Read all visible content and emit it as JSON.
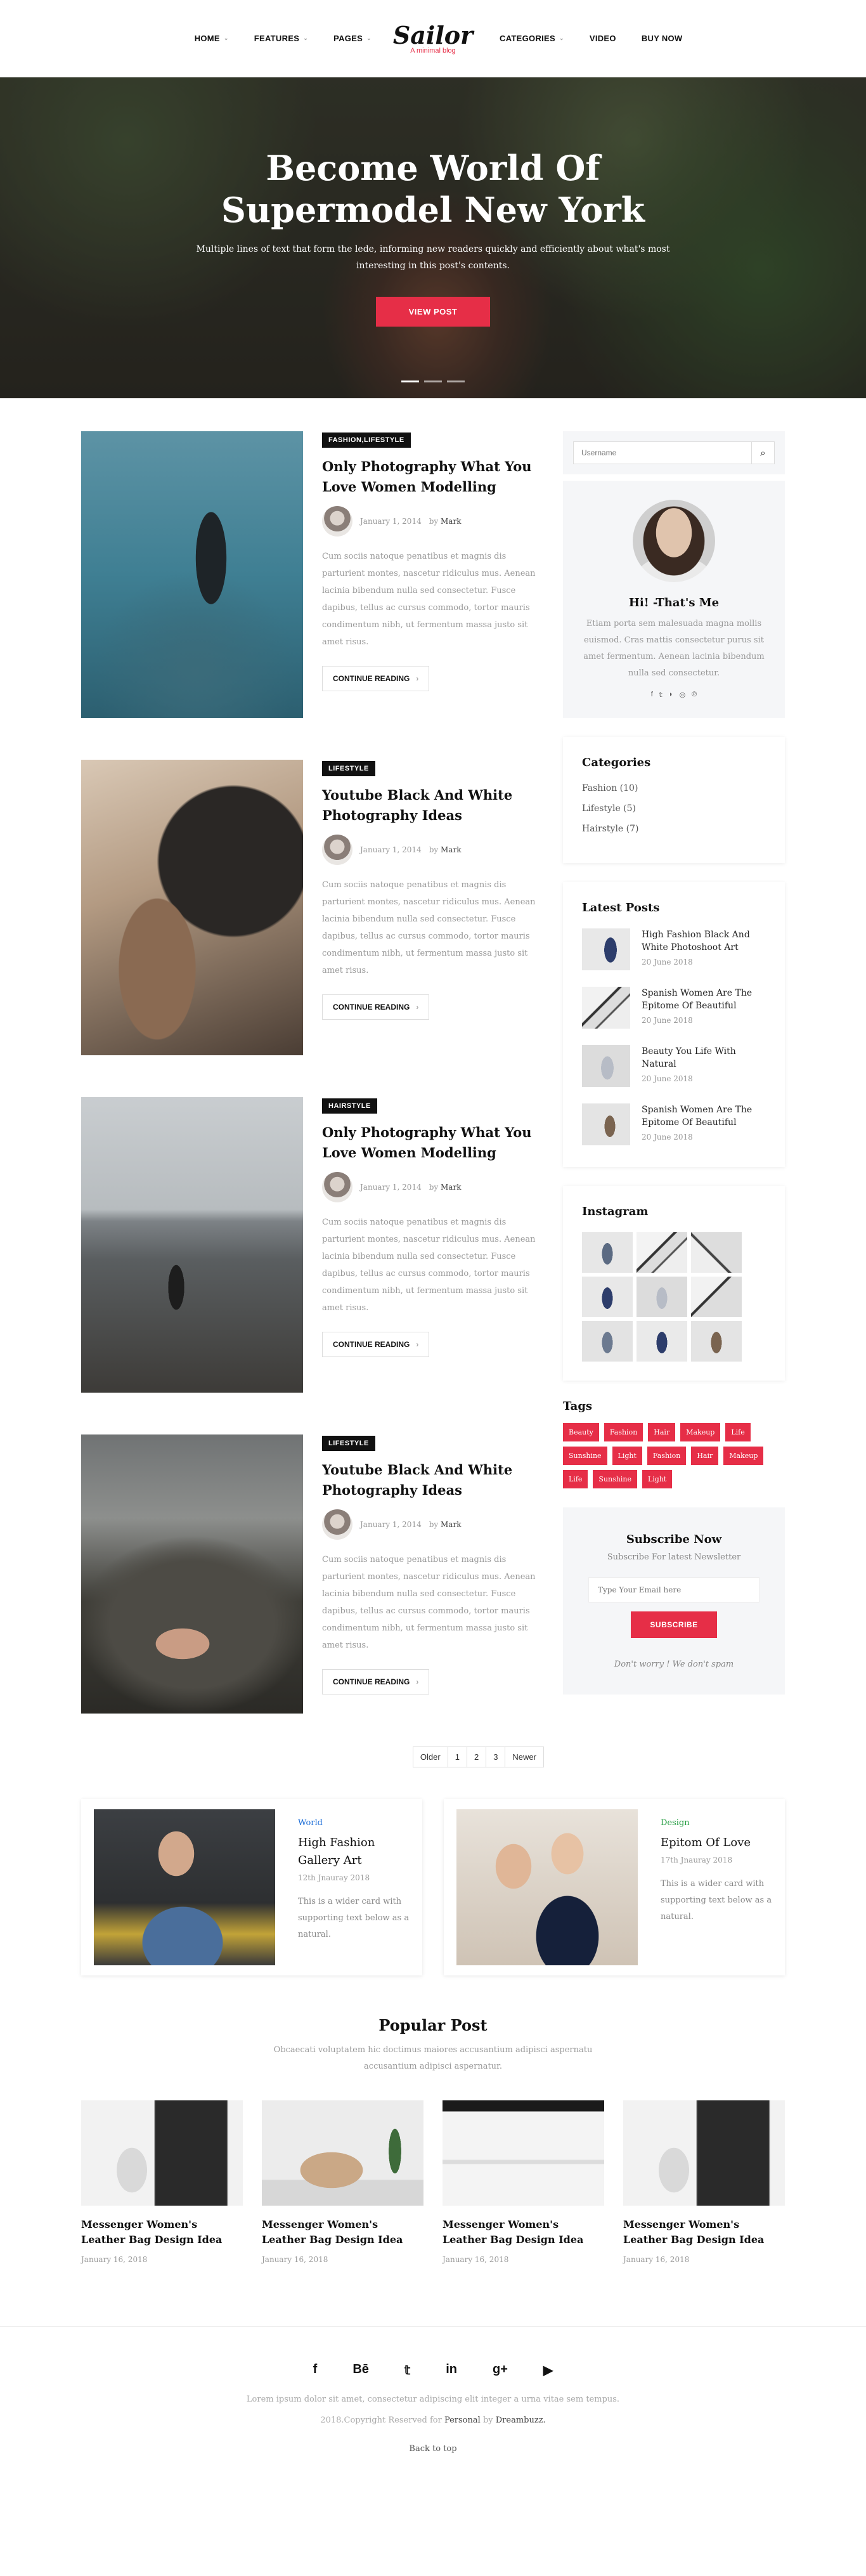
{
  "nav": {
    "left": [
      "HOME",
      "FEATURES",
      "PAGES"
    ],
    "right": [
      "CATEGORIES",
      "VIDEO",
      "BUY NOW"
    ]
  },
  "logo": {
    "title": "Sailor",
    "subtitle": "A minimal blog"
  },
  "hero": {
    "title": "Become World Of Supermodel New York",
    "text": "Multiple lines of text that form the lede, informing new readers quickly and efficiently about what's most interesting in this post's contents.",
    "button": "VIEW POST"
  },
  "posts": [
    {
      "tag": "FASHION,LIFESTYLE",
      "title": "Only Photography What You Love Women Modelling",
      "date": "January 1, 2014",
      "by": "by",
      "author": "Mark",
      "excerpt": "Cum sociis natoque penatibus et magnis dis parturient montes, nascetur ridiculus mus. Aenean lacinia bibendum nulla sed consectetur. Fusce dapibus, tellus ac cursus commodo, tortor mauris condimentum nibh, ut fermentum massa justo sit amet risus.",
      "more": "CONTINUE READING"
    },
    {
      "tag": "LIFESTYLE",
      "title": "Youtube Black And White Photography Ideas",
      "date": "January 1, 2014",
      "by": "by",
      "author": "Mark",
      "excerpt": "Cum sociis natoque penatibus et magnis dis parturient montes, nascetur ridiculus mus. Aenean lacinia bibendum nulla sed consectetur. Fusce dapibus, tellus ac cursus commodo, tortor mauris condimentum nibh, ut fermentum massa justo sit amet risus.",
      "more": "CONTINUE READING"
    },
    {
      "tag": "HAIRSTYLE",
      "title": "Only Photography What You Love Women Modelling",
      "date": "January 1, 2014",
      "by": "by",
      "author": "Mark",
      "excerpt": "Cum sociis natoque penatibus et magnis dis parturient montes, nascetur ridiculus mus. Aenean lacinia bibendum nulla sed consectetur. Fusce dapibus, tellus ac cursus commodo, tortor mauris condimentum nibh, ut fermentum massa justo sit amet risus.",
      "more": "CONTINUE READING"
    },
    {
      "tag": "LIFESTYLE",
      "title": "Youtube Black And White Photography Ideas",
      "date": "January 1, 2014",
      "by": "by",
      "author": "Mark",
      "excerpt": "Cum sociis natoque penatibus et magnis dis parturient montes, nascetur ridiculus mus. Aenean lacinia bibendum nulla sed consectetur. Fusce dapibus, tellus ac cursus commodo, tortor mauris condimentum nibh, ut fermentum massa justo sit amet risus.",
      "more": "CONTINUE READING"
    }
  ],
  "pager": [
    "Older",
    "1",
    "2",
    "3",
    "Newer"
  ],
  "sidebar": {
    "search_placeholder": "Username",
    "about": {
      "title": "Hi! -That's Me",
      "text": "Etiam porta sem malesuada magna mollis euismod. Cras mattis consectetur purus sit amet fermentum. Aenean lacinia bibendum nulla sed consectetur."
    },
    "categories_title": "Categories",
    "categories": [
      "Fashion (10)",
      "Lifestyle (5)",
      "Hairstyle (7)"
    ],
    "latest_title": "Latest Posts",
    "latest": [
      {
        "title": "High Fashion Black And White Photoshoot Art",
        "date": "20 June 2018"
      },
      {
        "title": "Spanish Women Are The Epitome Of Beautiful",
        "date": "20 June 2018"
      },
      {
        "title": "Beauty You Life With Natural",
        "date": "20 June 2018"
      },
      {
        "title": "Spanish Women Are The Epitome Of Beautiful",
        "date": "20 June 2018"
      }
    ],
    "instagram_title": "Instagram",
    "tags_title": "Tags",
    "tags": [
      "Beauty",
      "Fashion",
      "Hair",
      "Makeup",
      "Life",
      "Sunshine",
      "Light",
      "Fashion",
      "Hair",
      "Makeup",
      "Life",
      "Sunshine",
      "Light"
    ],
    "subscribe": {
      "title": "Subscribe Now",
      "sub": "Subscribe For latest Newsletter",
      "placeholder": "Type Your Email here",
      "button": "SUBSCRIBE",
      "note": "Don't worry ! We don't spam"
    }
  },
  "features": [
    {
      "cat": "World",
      "cat_color": "#1f6fd8",
      "title": "High Fashion Gallery Art",
      "date": "12th Jnauray 2018",
      "text": "This is a wider card with supporting text below as a natural."
    },
    {
      "cat": "Design",
      "cat_color": "#1e9a3c",
      "title": "Epitom Of Love",
      "date": "17th Jnauray 2018",
      "text": "This is a wider card with supporting text below as a natural."
    }
  ],
  "popular": {
    "title": "Popular Post",
    "text": "Obcaecati voluptatem hic doctimus maiores accusantium adipisci aspernatu accusantium adipisci aspernatur.",
    "items": [
      {
        "title": "Messenger Women's Leather Bag Design Idea",
        "date": "January 16, 2018"
      },
      {
        "title": "Messenger Women's Leather Bag Design Idea",
        "date": "January 16, 2018"
      },
      {
        "title": "Messenger Women's Leather Bag Design Idea",
        "date": "January 16, 2018"
      },
      {
        "title": "Messenger Women's Leather Bag Design Idea",
        "date": "January 16, 2018"
      }
    ]
  },
  "footer": {
    "icons": [
      "f",
      "Bē",
      "𝕥",
      "in",
      "g+",
      "▶"
    ],
    "text": "Lorem ipsum dolor sit amet, consectetur adipiscing elit integer a urna vitae sem tempus.",
    "copy_pre": "2018.Copyright Reserved for",
    "copy_a": "Personal",
    "copy_mid": "by",
    "copy_b": "Dreambuzz.",
    "top": "Back to top"
  },
  "colors": {
    "accent": "#e62e47"
  }
}
